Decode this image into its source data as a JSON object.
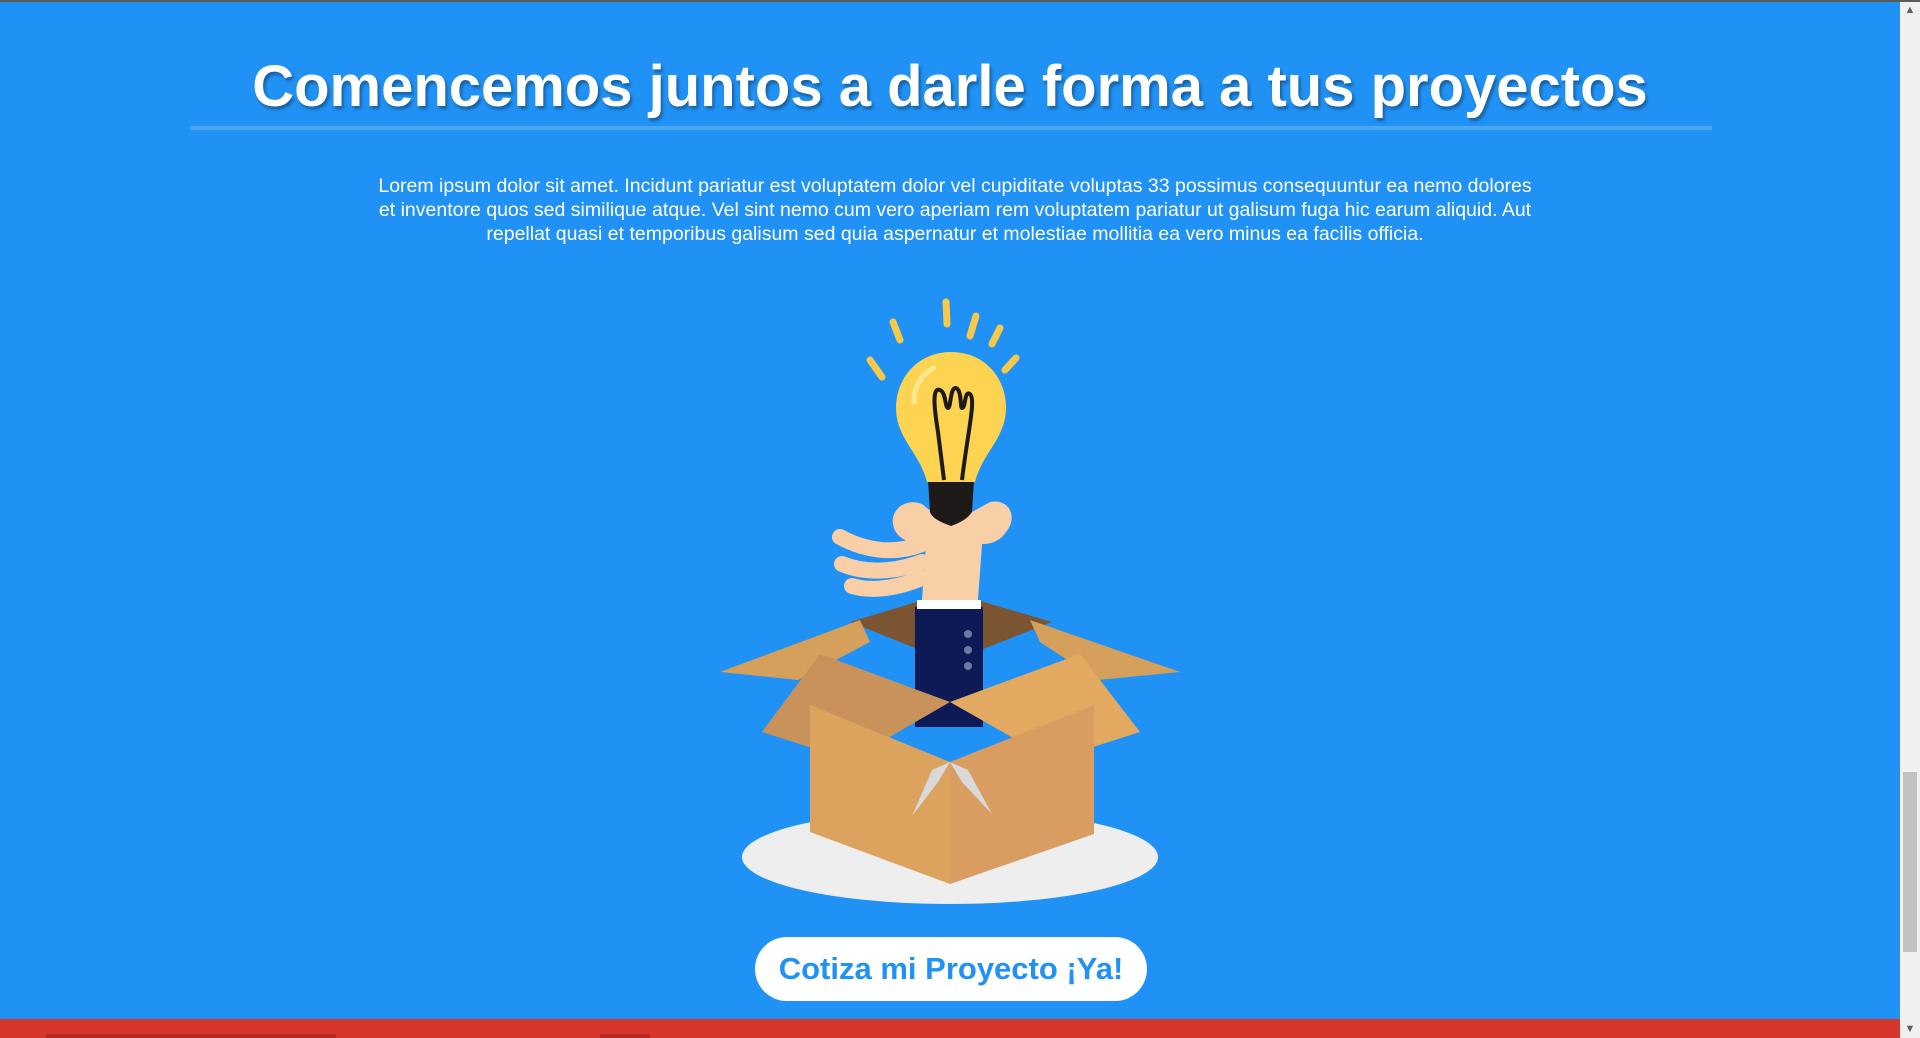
{
  "hero": {
    "title": "Comencemos juntos a darle forma a tus proyectos",
    "description": "Lorem ipsum dolor sit amet. Incidunt pariatur est voluptatem dolor vel cupiditate voluptas 33 possimus consequuntur ea nemo dolores et inventore quos sed similique atque. Vel sint nemo cum vero aperiam rem voluptatem pariatur ut galisum fuga hic earum aliquid. Aut repellat quasi et temporibus galisum sed quia aspernatur et molestiae mollitia ea vero minus ea facilis officia.",
    "illustration_icon": "idea-bulb-from-box-illustration",
    "cta_label": "Cotiza mi Proyecto ¡Ya!"
  },
  "colors": {
    "background": "#2192f5",
    "cta_background": "#ffffff",
    "cta_text": "#2192f5",
    "footer_bar": "#d6362b"
  },
  "scrollbar": {
    "up_icon": "chevron-up-icon",
    "down_icon": "chevron-down-icon"
  }
}
